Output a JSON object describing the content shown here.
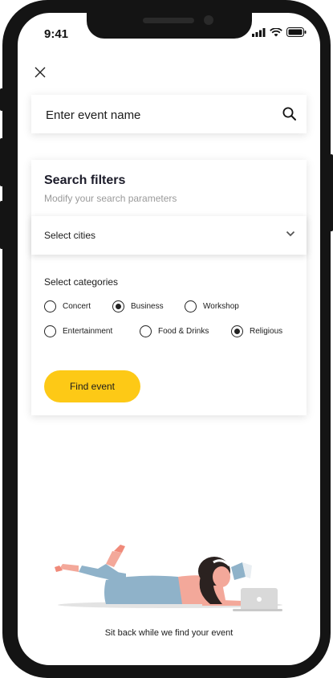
{
  "status_bar": {
    "time": "9:41"
  },
  "search": {
    "placeholder": "Enter event name"
  },
  "filters": {
    "title": "Search filters",
    "subtitle": "Modify your search parameters",
    "city_select": {
      "label": "Select cities"
    },
    "categories_title": "Select categories",
    "categories": [
      {
        "label": "Concert",
        "selected": false
      },
      {
        "label": "Business",
        "selected": true
      },
      {
        "label": "Workshop",
        "selected": false
      },
      {
        "label": "Entertainment",
        "selected": false
      },
      {
        "label": "Food & Drinks",
        "selected": false
      },
      {
        "label": "Religious",
        "selected": true
      }
    ],
    "find_button": "Find event"
  },
  "footer": {
    "caption": "Sit back while we find your event"
  },
  "colors": {
    "accent": "#FDC916",
    "frame": "#141414"
  }
}
